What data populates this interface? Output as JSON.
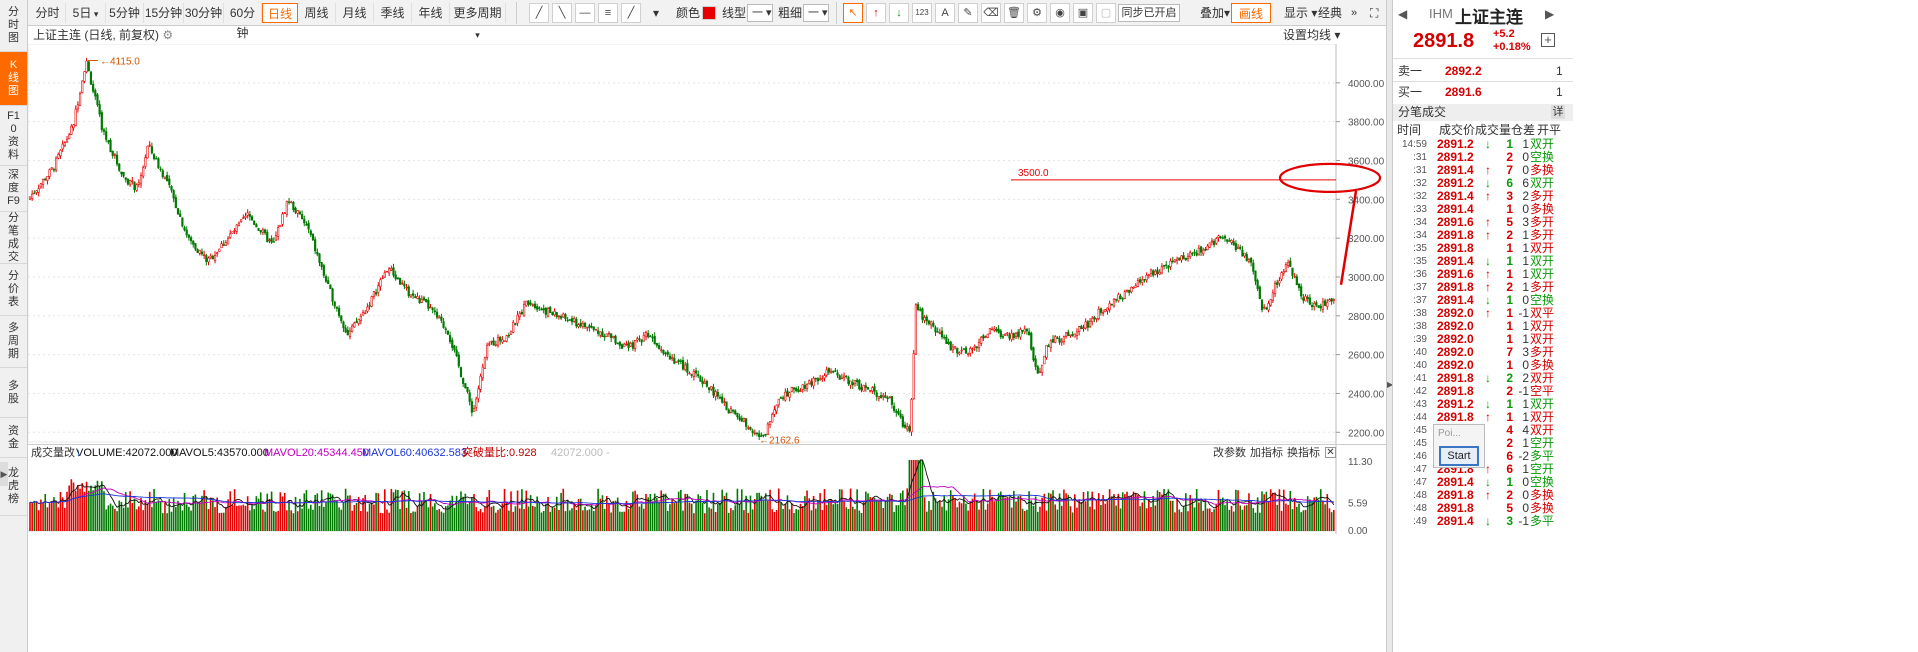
{
  "left_tabs": [
    "分时图",
    "K线图",
    "F10资料",
    "深度F9",
    "分笔成交",
    "分价表",
    "多周期",
    "多股",
    "资金",
    "龙虎榜"
  ],
  "left_tab_active": 1,
  "periods": [
    "分时",
    "5日",
    "5分钟",
    "15分钟",
    "30分钟",
    "60分钟",
    "日线",
    "周线",
    "月线",
    "季线",
    "年线",
    "更多周期"
  ],
  "period_active": 6,
  "toolbar": {
    "color_label": "颜色",
    "line_type_label": "线型",
    "line_type_value": "一",
    "width_label": "粗细",
    "width_value": "一",
    "sync_label": "同步已开启",
    "overlay_label": "叠加",
    "draw_label": "画线",
    "display_label": "显示",
    "classic_label": "经典",
    "draw_color": "#e60000"
  },
  "chart": {
    "title": "上证主连 (日线, 前复权)",
    "ma_setting": "设置均线",
    "high_label": "4115.0",
    "low_label": "2162.6",
    "hline_label": "3500.0"
  },
  "chart_data": {
    "type": "candlestick",
    "title": "上证主连 (日线, 前复权)",
    "ylim": [
      2150,
      4200
    ],
    "y_ticks": [
      2200,
      2400,
      2600,
      2800,
      3000,
      3200,
      3400,
      3600,
      3800,
      4000
    ],
    "y_tick_labels": [
      "2200.00",
      "2400.00",
      "2600.00",
      "2800.00",
      "3000.00",
      "3200.00",
      "3400.00",
      "3600.00",
      "3800.00",
      "4000.00"
    ],
    "price_path": [
      [
        0,
        3400
      ],
      [
        25,
        3560
      ],
      [
        45,
        3780
      ],
      [
        58,
        4115
      ],
      [
        75,
        3750
      ],
      [
        95,
        3520
      ],
      [
        110,
        3450
      ],
      [
        120,
        3680
      ],
      [
        140,
        3480
      ],
      [
        160,
        3200
      ],
      [
        180,
        3080
      ],
      [
        200,
        3200
      ],
      [
        220,
        3320
      ],
      [
        245,
        3160
      ],
      [
        260,
        3400
      ],
      [
        280,
        3250
      ],
      [
        300,
        2950
      ],
      [
        320,
        2700
      ],
      [
        340,
        2850
      ],
      [
        360,
        3050
      ],
      [
        380,
        2920
      ],
      [
        400,
        2850
      ],
      [
        420,
        2720
      ],
      [
        445,
        2300
      ],
      [
        460,
        2650
      ],
      [
        480,
        2700
      ],
      [
        500,
        2880
      ],
      [
        520,
        2820
      ],
      [
        540,
        2780
      ],
      [
        560,
        2740
      ],
      [
        580,
        2700
      ],
      [
        600,
        2630
      ],
      [
        620,
        2710
      ],
      [
        640,
        2600
      ],
      [
        660,
        2520
      ],
      [
        680,
        2440
      ],
      [
        700,
        2320
      ],
      [
        720,
        2240
      ],
      [
        735,
        2162
      ],
      [
        750,
        2380
      ],
      [
        775,
        2440
      ],
      [
        800,
        2510
      ],
      [
        820,
        2470
      ],
      [
        840,
        2420
      ],
      [
        860,
        2380
      ],
      [
        875,
        2240
      ],
      [
        882,
        2220
      ],
      [
        888,
        2870
      ],
      [
        895,
        2790
      ],
      [
        905,
        2750
      ],
      [
        920,
        2650
      ],
      [
        940,
        2600
      ],
      [
        960,
        2720
      ],
      [
        980,
        2700
      ],
      [
        1000,
        2720
      ],
      [
        1010,
        2480
      ],
      [
        1020,
        2660
      ],
      [
        1040,
        2700
      ],
      [
        1060,
        2760
      ],
      [
        1080,
        2860
      ],
      [
        1100,
        2920
      ],
      [
        1120,
        3010
      ],
      [
        1140,
        3060
      ],
      [
        1160,
        3110
      ],
      [
        1180,
        3150
      ],
      [
        1192,
        3220
      ],
      [
        1210,
        3150
      ],
      [
        1225,
        3050
      ],
      [
        1235,
        2820
      ],
      [
        1250,
        2980
      ],
      [
        1260,
        3070
      ],
      [
        1275,
        2900
      ],
      [
        1290,
        2840
      ],
      [
        1310,
        2910
      ]
    ],
    "hline_value": 3500
  },
  "volume": {
    "title": "成交量改",
    "volume": "VOLUME:42072.000",
    "mavol5": "MAVOL5:43570.000",
    "mavol20": "MAVOL20:45344.450",
    "mavol60": "MAVOL60:40632.583",
    "break_ratio": "突破量比:0.928",
    "ghost": "42072.000 -",
    "params": "改参数",
    "add_indicator": "加指标",
    "switch_indicator": "换指标",
    "close": "✕",
    "y_ticks": [
      "11.30",
      "5.59",
      "0.00"
    ],
    "y_unit": "万"
  },
  "quote": {
    "code": "IHM",
    "name": "上证主连",
    "price": "2891.8",
    "change": "+5.2",
    "change_pct": "+0.18%",
    "ask_label": "卖一",
    "ask_price": "2892.2",
    "ask_vol": "1",
    "bid_label": "买一",
    "bid_price": "2891.6",
    "bid_vol": "1"
  },
  "ticks_header": {
    "title": "分笔成交",
    "detail": "详",
    "cols": [
      "时间",
      "成交价",
      "成交量",
      "仓差",
      "开平"
    ]
  },
  "ticks": [
    {
      "time": "14:59",
      "price": "2891.2",
      "dir": "down",
      "vol": "1",
      "oi": "1",
      "nat": "双开",
      "nat_color": "#0a9a0a"
    },
    {
      "time": ":31",
      "price": "2891.2",
      "dir": "",
      "vol": "2",
      "oi": "0",
      "nat": "空换",
      "nat_color": "#0a9a0a"
    },
    {
      "time": ":31",
      "price": "2891.4",
      "dir": "up",
      "vol": "7",
      "oi": "0",
      "nat": "多换",
      "nat_color": "#d40000"
    },
    {
      "time": ":32",
      "price": "2891.2",
      "dir": "down",
      "vol": "6",
      "oi": "6",
      "nat": "双开",
      "nat_color": "#0a9a0a"
    },
    {
      "time": ":32",
      "price": "2891.4",
      "dir": "up",
      "vol": "3",
      "oi": "2",
      "nat": "多开",
      "nat_color": "#d40000"
    },
    {
      "time": ":33",
      "price": "2891.4",
      "dir": "",
      "vol": "1",
      "oi": "0",
      "nat": "多换",
      "nat_color": "#d40000"
    },
    {
      "time": ":34",
      "price": "2891.6",
      "dir": "up",
      "vol": "5",
      "oi": "3",
      "nat": "多开",
      "nat_color": "#d40000"
    },
    {
      "time": ":34",
      "price": "2891.8",
      "dir": "up",
      "vol": "2",
      "oi": "1",
      "nat": "多开",
      "nat_color": "#d40000"
    },
    {
      "time": ":35",
      "price": "2891.8",
      "dir": "",
      "vol": "1",
      "oi": "1",
      "nat": "双开",
      "nat_color": "#d40000"
    },
    {
      "time": ":35",
      "price": "2891.4",
      "dir": "down",
      "vol": "1",
      "oi": "1",
      "nat": "双开",
      "nat_color": "#0a9a0a"
    },
    {
      "time": ":36",
      "price": "2891.6",
      "dir": "up",
      "vol": "1",
      "oi": "1",
      "nat": "双开",
      "nat_color": "#0a9a0a"
    },
    {
      "time": ":37",
      "price": "2891.8",
      "dir": "up",
      "vol": "2",
      "oi": "1",
      "nat": "多开",
      "nat_color": "#d40000"
    },
    {
      "time": ":37",
      "price": "2891.4",
      "dir": "down",
      "vol": "1",
      "oi": "0",
      "nat": "空换",
      "nat_color": "#0a9a0a"
    },
    {
      "time": ":38",
      "price": "2892.0",
      "dir": "up",
      "vol": "1",
      "oi": "-1",
      "nat": "双平",
      "nat_color": "#d40000"
    },
    {
      "time": ":38",
      "price": "2892.0",
      "dir": "",
      "vol": "1",
      "oi": "1",
      "nat": "双开",
      "nat_color": "#d40000"
    },
    {
      "time": ":39",
      "price": "2892.0",
      "dir": "",
      "vol": "1",
      "oi": "1",
      "nat": "双开",
      "nat_color": "#d40000"
    },
    {
      "time": ":40",
      "price": "2892.0",
      "dir": "",
      "vol": "7",
      "oi": "3",
      "nat": "多开",
      "nat_color": "#d40000"
    },
    {
      "time": ":40",
      "price": "2892.0",
      "dir": "",
      "vol": "1",
      "oi": "0",
      "nat": "多换",
      "nat_color": "#d40000"
    },
    {
      "time": ":41",
      "price": "2891.8",
      "dir": "down",
      "vol": "2",
      "oi": "2",
      "nat": "双开",
      "nat_color": "#d40000"
    },
    {
      "time": ":42",
      "price": "2891.8",
      "dir": "",
      "vol": "2",
      "oi": "-1",
      "nat": "空平",
      "nat_color": "#d40000"
    },
    {
      "time": ":43",
      "price": "2891.2",
      "dir": "down",
      "vol": "1",
      "oi": "1",
      "nat": "双开",
      "nat_color": "#0a9a0a"
    },
    {
      "time": ":44",
      "price": "2891.8",
      "dir": "up",
      "vol": "1",
      "oi": "1",
      "nat": "双开",
      "nat_color": "#d40000"
    },
    {
      "time": ":45",
      "price": "",
      "dir": "",
      "vol": "4",
      "oi": "4",
      "nat": "双开",
      "nat_color": "#d40000"
    },
    {
      "time": ":45",
      "price": "",
      "dir": "",
      "vol": "2",
      "oi": "1",
      "nat": "空开",
      "nat_color": "#0a9a0a"
    },
    {
      "time": ":46",
      "price": "",
      "dir": "",
      "vol": "6",
      "oi": "-2",
      "nat": "多平",
      "nat_color": "#0a9a0a"
    },
    {
      "time": ":47",
      "price": "2891.8",
      "dir": "up",
      "vol": "6",
      "oi": "1",
      "nat": "空开",
      "nat_color": "#0a9a0a"
    },
    {
      "time": ":47",
      "price": "2891.4",
      "dir": "down",
      "vol": "1",
      "oi": "0",
      "nat": "空换",
      "nat_color": "#0a9a0a"
    },
    {
      "time": ":48",
      "price": "2891.8",
      "dir": "up",
      "vol": "2",
      "oi": "0",
      "nat": "多换",
      "nat_color": "#d40000"
    },
    {
      "time": ":48",
      "price": "2891.8",
      "dir": "",
      "vol": "5",
      "oi": "0",
      "nat": "多换",
      "nat_color": "#d40000"
    },
    {
      "time": ":49",
      "price": "2891.4",
      "dir": "down",
      "vol": "3",
      "oi": "-1",
      "nat": "多平",
      "nat_color": "#0a9a0a"
    }
  ],
  "popup": {
    "title": "Poi...",
    "button": "Start"
  }
}
